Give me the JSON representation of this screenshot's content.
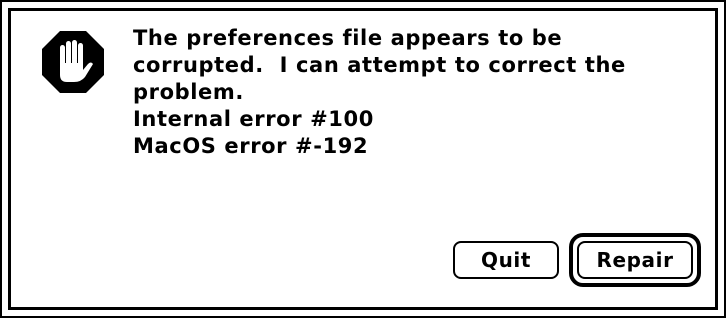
{
  "dialog": {
    "icon": "stop-hand-icon",
    "message_lines": [
      "The preferences file appears to be",
      "corrupted.  I can attempt to correct the",
      "problem.",
      "Internal error #100",
      "MacOS error #-192"
    ]
  },
  "buttons": {
    "quit_label": "Quit",
    "repair_label": "Repair",
    "default": "repair"
  },
  "colors": {
    "background": "#ffffff",
    "foreground": "#000000"
  }
}
